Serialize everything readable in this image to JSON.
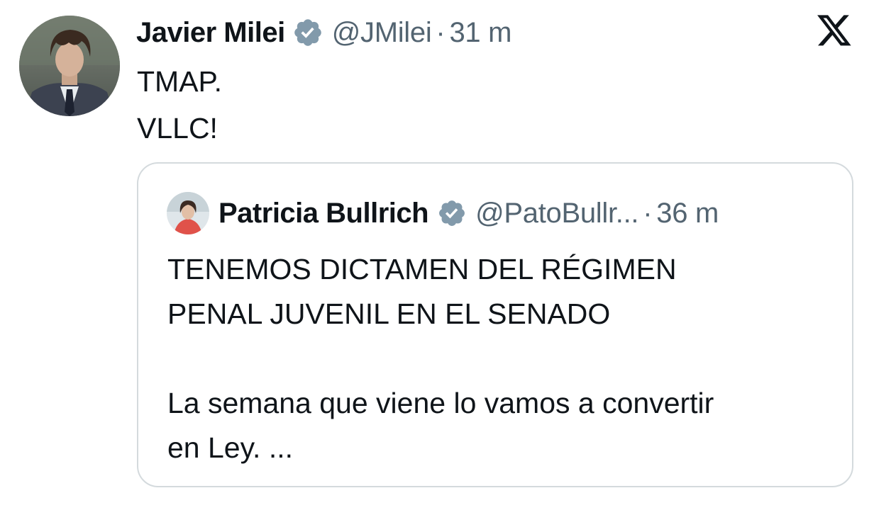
{
  "tweet": {
    "author": {
      "display_name": "Javier Milei",
      "handle": "@JMilei",
      "time": "31 m",
      "separator": "·"
    },
    "text_lines": [
      "TMAP.",
      "VLLC!"
    ],
    "platform_icon": "x-logo-icon"
  },
  "quote": {
    "author": {
      "display_name": "Patricia Bullrich",
      "handle": "@PatoBullr...",
      "time": "36 m",
      "separator": "·"
    },
    "paragraphs": [
      [
        "TENEMOS DICTAMEN DEL RÉGIMEN",
        "PENAL JUVENIL EN EL SENADO"
      ],
      [
        "La semana que viene lo vamos a convertir",
        "en Ley. ..."
      ]
    ]
  },
  "colors": {
    "text_primary": "#0f1419",
    "text_secondary": "#536471",
    "verified_badge": "#829aab",
    "card_border": "#d4dadd"
  }
}
